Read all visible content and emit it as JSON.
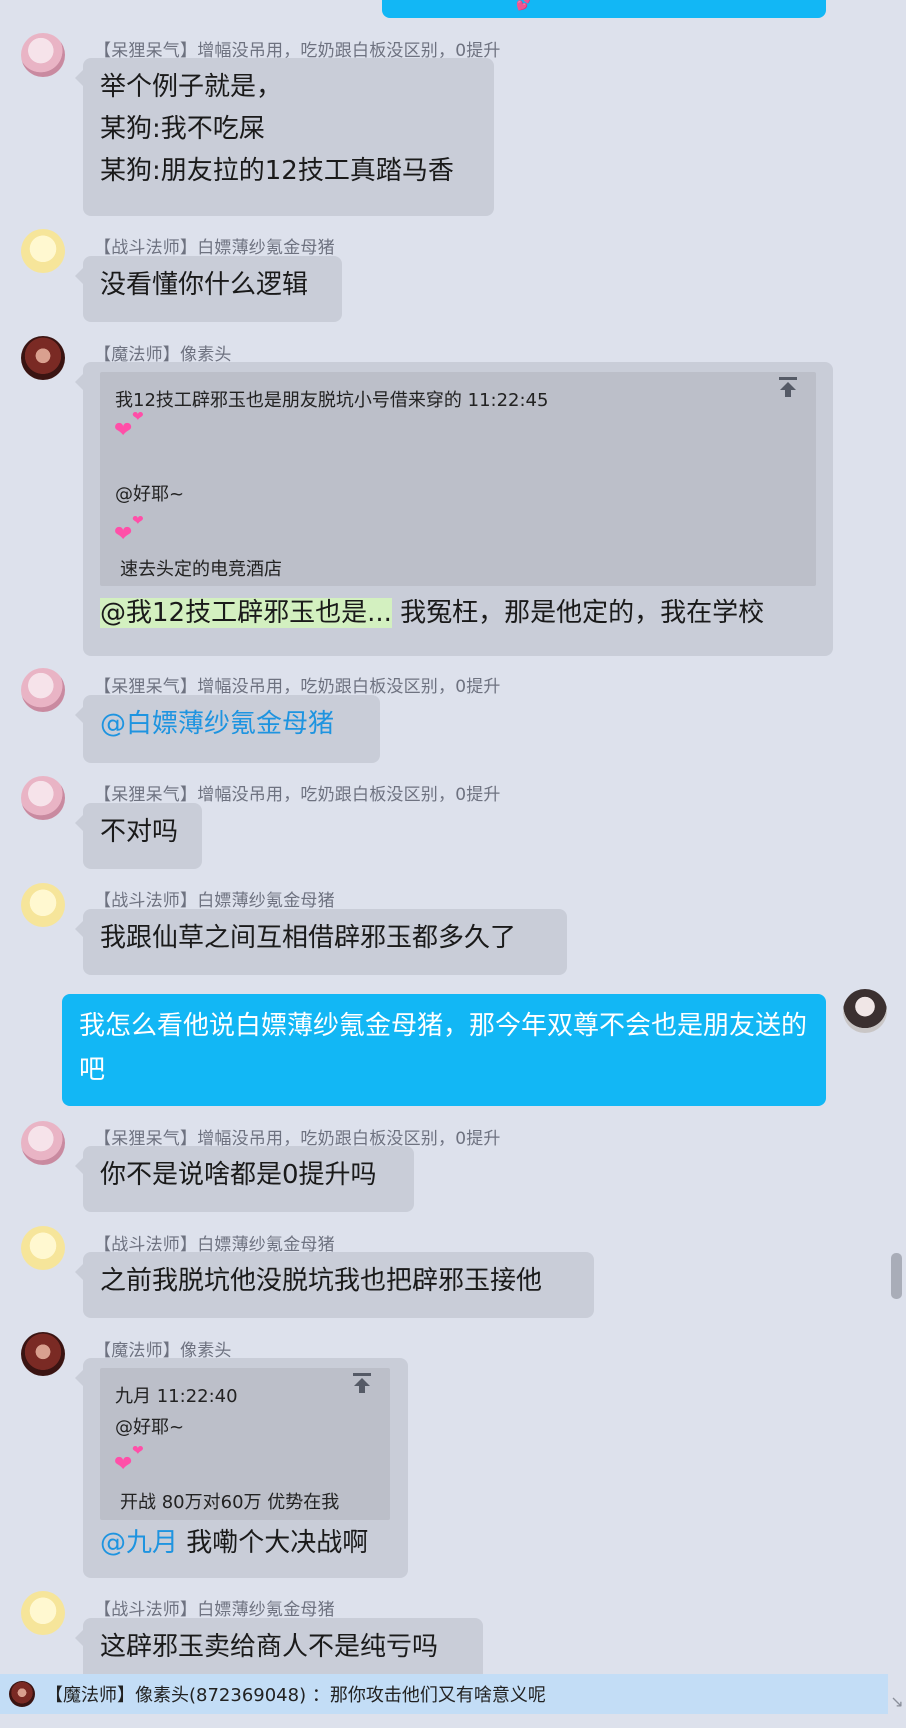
{
  "messages": [
    {
      "sender": "【呆狸呆气】增幅没吊用，吃奶跟白板没区别，0提升",
      "lines": [
        "举个例子就是，",
        "某狗:我不吃屎",
        "某狗:朋友拉的12技工真踏马香"
      ]
    },
    {
      "sender": "【战斗法师】白嫖薄纱氪金母猪",
      "text": "没看懂你什么逻辑"
    },
    {
      "sender": "【魔法师】像素头",
      "quote": {
        "header": "我12技工辟邪玉也是朋友脱坑小号借来穿的    11:22:45",
        "mention": "@好耶~",
        "body": "速去头定的电竞酒店"
      },
      "highlight": "@我12技工辟邪玉也是...",
      "text": " 我冤枉，那是他定的，我在学校"
    },
    {
      "sender": "【呆狸呆气】增幅没吊用，吃奶跟白板没区别，0提升",
      "mention": "@白嫖薄纱氪金母猪"
    },
    {
      "sender": "【呆狸呆气】增幅没吊用，吃奶跟白板没区别，0提升",
      "text": "不对吗"
    },
    {
      "sender": "【战斗法师】白嫖薄纱氪金母猪",
      "text": "我跟仙草之间互相借辟邪玉都多久了"
    },
    {
      "self": true,
      "text": "我怎么看他说白嫖薄纱氪金母猪，那今年双尊不会也是朋友送的吧"
    },
    {
      "sender": "【呆狸呆气】增幅没吊用，吃奶跟白板没区别，0提升",
      "text": "你不是说啥都是0提升吗"
    },
    {
      "sender": "【战斗法师】白嫖薄纱氪金母猪",
      "text": "之前我脱坑他没脱坑我也把辟邪玉接他"
    },
    {
      "sender": "【魔法师】像素头",
      "quote": {
        "header": "九月    11:22:40",
        "mention": "@好耶~",
        "body": "开战 80万对60万  优势在我"
      },
      "mention": "@九月",
      "text": " 我嘞个大决战啊"
    },
    {
      "sender": "【战斗法师】白嫖薄纱氪金母猪",
      "text": "这辟邪玉卖给商人不是纯亏吗"
    }
  ],
  "notice": {
    "text": "【魔法师】像素头(872369048) ：那你攻击他们又有啥意义呢"
  },
  "icons": {
    "heart": "💕",
    "quote_jump": "jump-to-top-icon",
    "resize": "↘"
  }
}
